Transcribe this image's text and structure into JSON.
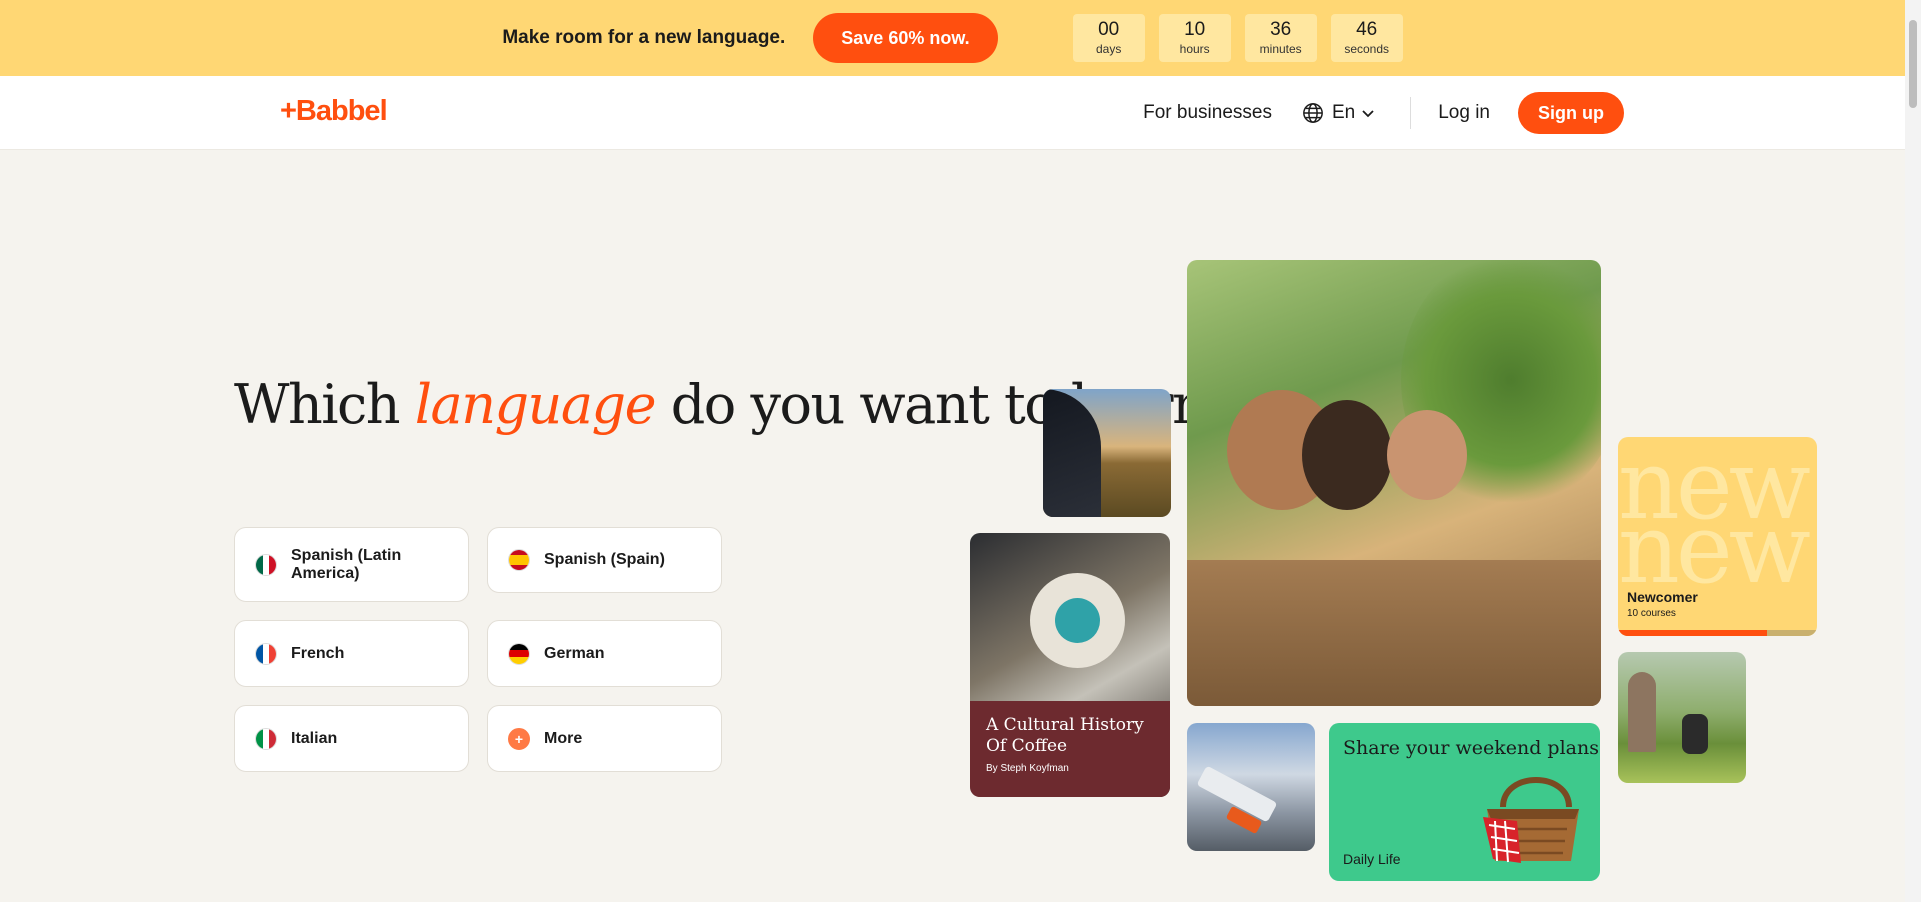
{
  "promo": {
    "text": "Make room for a new language.",
    "button": "Save 60% now.",
    "countdown": [
      {
        "value": "00",
        "label": "days"
      },
      {
        "value": "10",
        "label": "hours"
      },
      {
        "value": "36",
        "label": "minutes"
      },
      {
        "value": "46",
        "label": "seconds"
      }
    ]
  },
  "nav": {
    "logo": "+Babbel",
    "for_businesses": "For businesses",
    "language": "En",
    "login": "Log in",
    "signup": "Sign up"
  },
  "hero": {
    "title_pre": "Which ",
    "title_accent": "language",
    "title_post": " do you want to learn?"
  },
  "languages": [
    {
      "label": "Spanish (Latin America)"
    },
    {
      "label": "Spanish (Spain)"
    },
    {
      "label": "French"
    },
    {
      "label": "German"
    },
    {
      "label": "Italian"
    },
    {
      "label": "More"
    }
  ],
  "cards": {
    "coffee_title": "A Cultural History Of Coffee",
    "coffee_author": "By Steph Koyfman",
    "share_title": "Share your weekend plans",
    "share_tag": "Daily Life",
    "newcomer_word": "new",
    "newcomer_title": "Newcomer",
    "newcomer_sub": "10 courses",
    "newcomer_progress": 0.75
  },
  "colors": {
    "brand": "#ff4f0f",
    "banner": "#ffd774",
    "coffee": "#6d2a2f",
    "share": "#3ec98c"
  }
}
